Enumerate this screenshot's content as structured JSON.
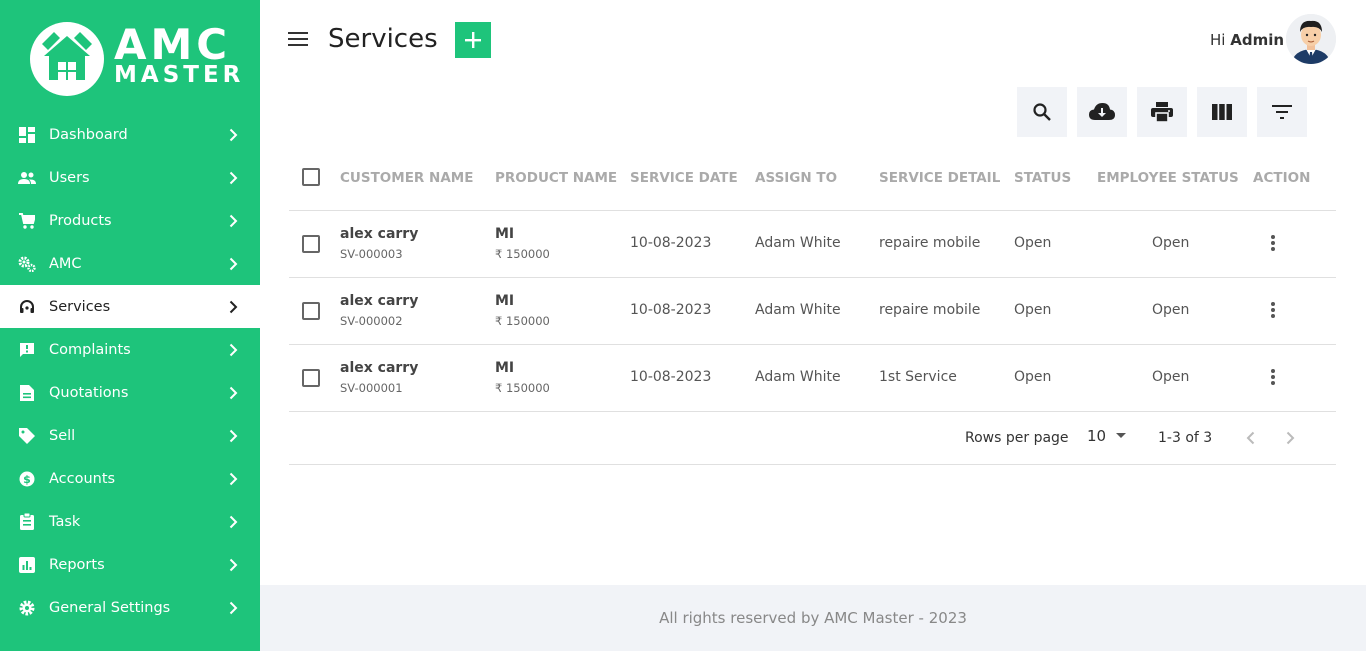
{
  "brand": {
    "line1": "AMC",
    "line2": "MASTER"
  },
  "sidebar": {
    "items": [
      {
        "label": "Dashboard",
        "icon": "dashboard-icon"
      },
      {
        "label": "Users",
        "icon": "users-icon"
      },
      {
        "label": "Products",
        "icon": "cart-icon"
      },
      {
        "label": "AMC",
        "icon": "gears-icon"
      },
      {
        "label": "Services",
        "icon": "headset-icon",
        "active": true
      },
      {
        "label": "Complaints",
        "icon": "feedback-icon"
      },
      {
        "label": "Quotations",
        "icon": "document-icon"
      },
      {
        "label": "Sell",
        "icon": "tag-icon"
      },
      {
        "label": "Accounts",
        "icon": "dollar-icon"
      },
      {
        "label": "Task",
        "icon": "clipboard-icon"
      },
      {
        "label": "Reports",
        "icon": "chart-icon"
      },
      {
        "label": "General Settings",
        "icon": "gear-icon"
      }
    ]
  },
  "header": {
    "title": "Services",
    "greeting_prefix": "Hi",
    "user_name": "Admin"
  },
  "toolbar": {
    "buttons": [
      "search-icon",
      "cloud-download-icon",
      "print-icon",
      "columns-icon",
      "filter-icon"
    ]
  },
  "table": {
    "columns": [
      "CUSTOMER NAME",
      "PRODUCT NAME",
      "SERVICE DATE",
      "ASSIGN TO",
      "SERVICE DETAIL",
      "STATUS",
      "EMPLOYEE STATUS",
      "ACTION"
    ],
    "rows": [
      {
        "customer": "alex carry",
        "service_id": "SV-000003",
        "product": "MI",
        "price": "₹ 150000",
        "date": "10-08-2023",
        "assign_to": "Adam White",
        "detail": "repaire mobile",
        "status": "Open",
        "employee_status": "Open"
      },
      {
        "customer": "alex carry",
        "service_id": "SV-000002",
        "product": "MI",
        "price": "₹ 150000",
        "date": "10-08-2023",
        "assign_to": "Adam White",
        "detail": "repaire mobile",
        "status": "Open",
        "employee_status": "Open"
      },
      {
        "customer": "alex carry",
        "service_id": "SV-000001",
        "product": "MI",
        "price": "₹ 150000",
        "date": "10-08-2023",
        "assign_to": "Adam White",
        "detail": "1st Service",
        "status": "Open",
        "employee_status": "Open"
      }
    ]
  },
  "pagination": {
    "rows_per_page_label": "Rows per page",
    "rows_per_page": "10",
    "range": "1-3 of 3"
  },
  "footer": {
    "text": "All rights reserved by AMC Master - 2023"
  },
  "colors": {
    "accent": "#1ec47b",
    "toolbar_bg": "#f1f3f7"
  }
}
